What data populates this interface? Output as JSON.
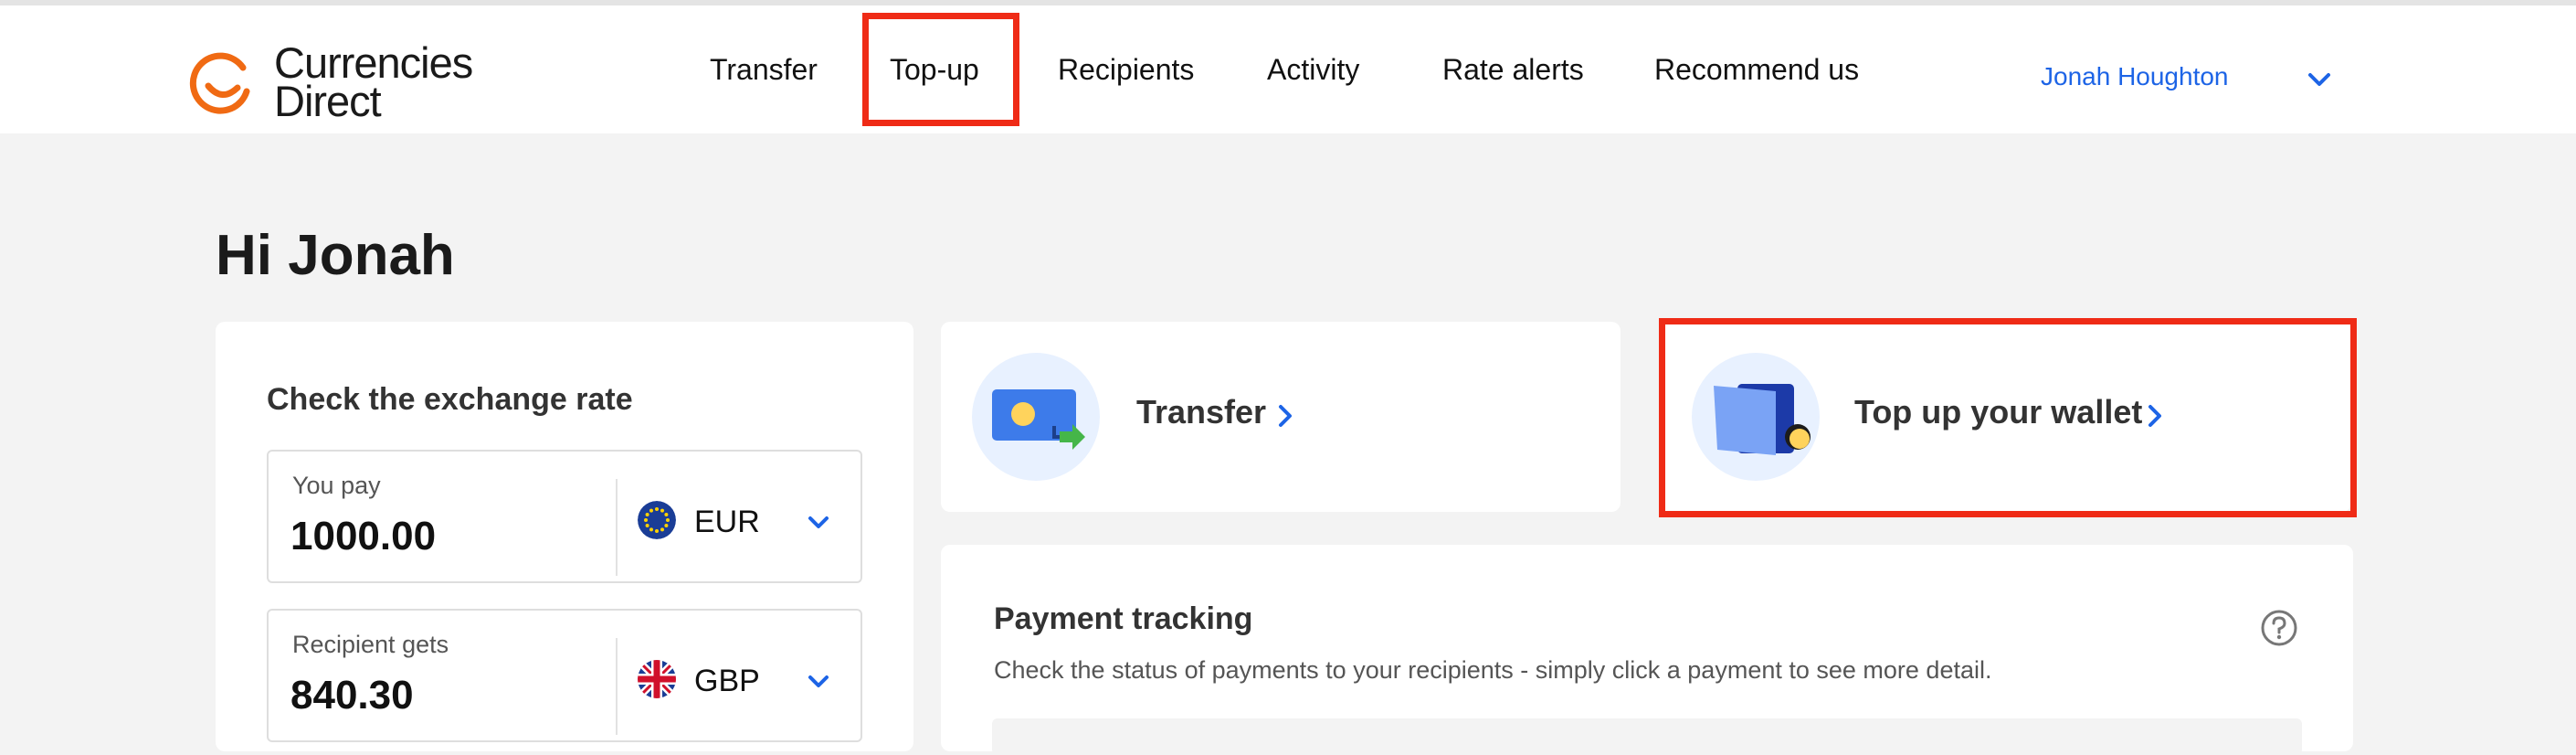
{
  "brand": {
    "logo_line1": "Currencies",
    "logo_line2": "Direct",
    "color": "#f06a13"
  },
  "nav": [
    {
      "label": "Transfer"
    },
    {
      "label": "Top-up"
    },
    {
      "label": "Recipients"
    },
    {
      "label": "Activity"
    },
    {
      "label": "Rate alerts"
    },
    {
      "label": "Recommend us"
    }
  ],
  "user": {
    "name": "Jonah Houghton"
  },
  "greeting": "Hi Jonah",
  "exchange": {
    "title": "Check the exchange rate",
    "pay": {
      "label": "You pay",
      "value": "1000.00",
      "currency": "EUR"
    },
    "get": {
      "label": "Recipient gets",
      "value": "840.30",
      "currency": "GBP"
    }
  },
  "actions": {
    "transfer": {
      "label": "Transfer"
    },
    "topup": {
      "label": "Top up your wallet"
    }
  },
  "tracking": {
    "title": "Payment tracking",
    "description": "Check the status of payments to your recipients - simply click a payment to see more detail."
  },
  "colors": {
    "accent": "#1d64e6",
    "highlight": "#ef2b16",
    "icon_bg": "#e8f1ff"
  },
  "icons": [
    "currencies-direct-logo",
    "chevron-down-icon",
    "eu-flag-icon",
    "uk-flag-icon",
    "transfer-money-icon",
    "wallet-icon",
    "chevron-right-icon",
    "help-icon"
  ]
}
